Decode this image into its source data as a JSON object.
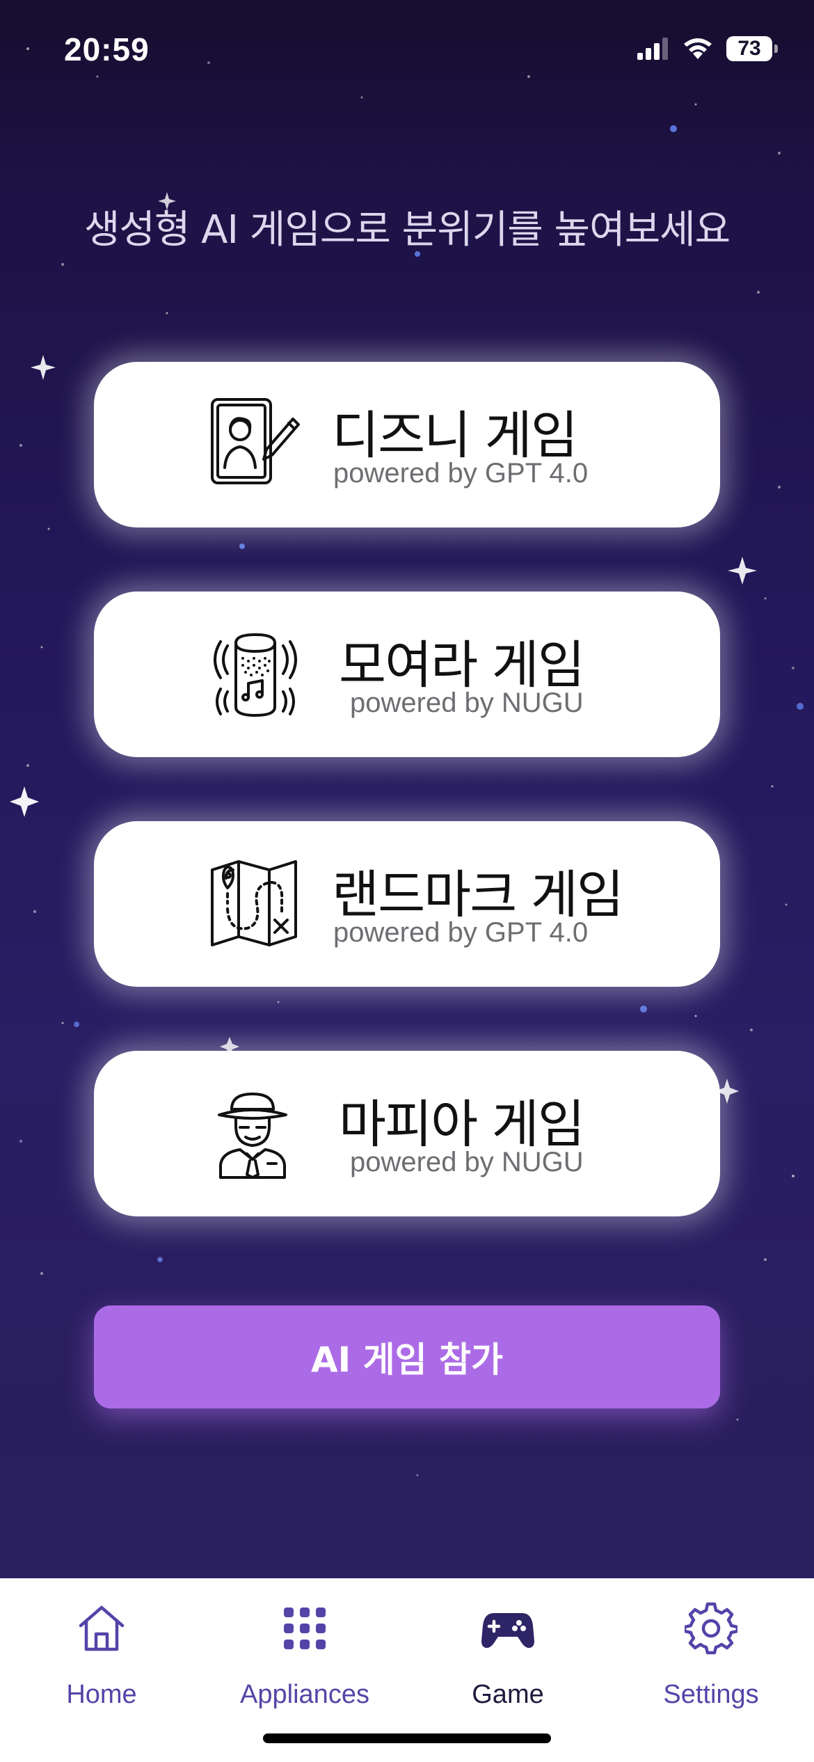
{
  "status_bar": {
    "time": "20:59",
    "battery": "73",
    "icons": [
      "signal-icon",
      "wifi-icon",
      "battery-icon"
    ]
  },
  "headline": "생성형 AI 게임으로 분위기를 높여보세요",
  "games": [
    {
      "title": "디즈니 게임",
      "subtitle": "powered by GPT 4.0",
      "icon": "tablet-drawing-icon"
    },
    {
      "title": "모여라 게임",
      "subtitle": "powered by NUGU",
      "icon": "smart-speaker-icon"
    },
    {
      "title": "랜드마크 게임",
      "subtitle": "powered by GPT 4.0",
      "icon": "treasure-map-icon"
    },
    {
      "title": "마피아 게임",
      "subtitle": "powered by NUGU",
      "icon": "detective-icon"
    }
  ],
  "cta": {
    "label": "AI 게임 참가"
  },
  "tabbar": {
    "active": "Game",
    "items": [
      {
        "label": "Home",
        "icon": "home-icon"
      },
      {
        "label": "Appliances",
        "icon": "grid-icon"
      },
      {
        "label": "Game",
        "icon": "gamepad-icon"
      },
      {
        "label": "Settings",
        "icon": "gear-icon"
      }
    ]
  },
  "colors": {
    "background_top": "#170d2e",
    "background_bottom": "#2b2160",
    "card": "#ffffff",
    "cta": "#ac6be6",
    "tab_inactive": "#5543a8",
    "tab_active": "#1f1a3c",
    "headline": "#dcd7ee"
  }
}
